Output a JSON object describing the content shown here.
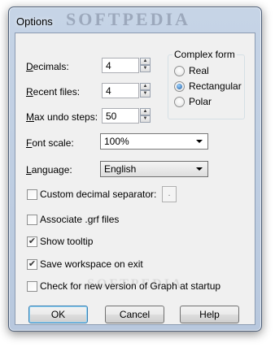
{
  "window": {
    "title": "Options",
    "title_watermark": "SOFTPEDIA"
  },
  "fields": {
    "decimals": {
      "label_u": "D",
      "label_rest": "ecimals:",
      "value": "4"
    },
    "recent_files": {
      "label_u": "R",
      "label_rest": "ecent files:",
      "value": "4"
    },
    "max_undo": {
      "label_u": "M",
      "label_rest": "ax undo steps:",
      "value": "50"
    },
    "font_scale": {
      "label_u": "F",
      "label_rest": "ont scale:",
      "value": "100%"
    },
    "language": {
      "label_u": "L",
      "label_rest": "anguage:",
      "value": "English"
    }
  },
  "complex_form": {
    "title": "Complex form",
    "options": [
      "Real",
      "Rectangular",
      "Polar"
    ],
    "selected": "Rectangular"
  },
  "checkboxes": {
    "custom_separator": {
      "label": "Custom decimal separator:",
      "checked": false,
      "value": "."
    },
    "associate_grf": {
      "label": "Associate .grf files",
      "checked": false
    },
    "show_tooltip": {
      "label": "Show tooltip",
      "checked": true
    },
    "save_workspace": {
      "label": "Save workspace on exit",
      "checked": true
    },
    "check_version": {
      "label": "Check for new version of Graph at startup",
      "checked": false
    }
  },
  "buttons": {
    "ok": "OK",
    "cancel": "Cancel",
    "help": "Help"
  },
  "watermark": "SOFTPEDIA",
  "icons": {
    "check": "check-icon",
    "spin_up": "arrow-up-icon",
    "spin_down": "arrow-down-icon",
    "dropdown": "chevron-down-icon"
  }
}
